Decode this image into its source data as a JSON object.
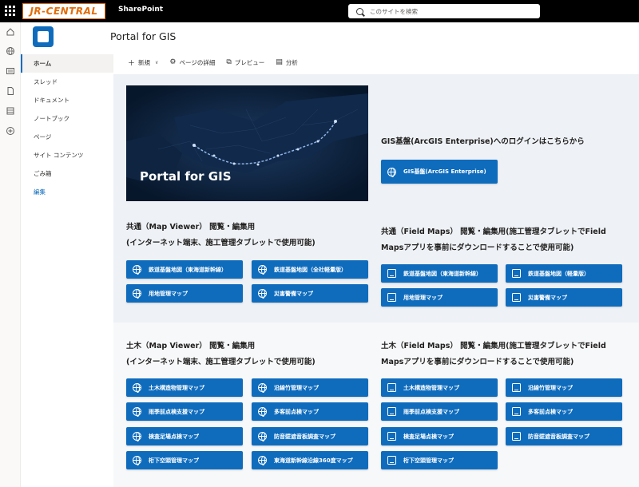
{
  "topbar": {
    "brand": "JR-CENTRAL",
    "app_name": "SharePoint",
    "search_placeholder": "このサイトを検索"
  },
  "site": {
    "title": "Portal for GIS"
  },
  "nav": {
    "items": [
      "ホーム",
      "スレッド",
      "ドキュメント",
      "ノートブック",
      "ページ",
      "サイト コンテンツ",
      "ごみ箱"
    ],
    "edit": "編集"
  },
  "commands": {
    "new": "新規",
    "details": "ページの詳細",
    "preview": "プレビュー",
    "analytics": "分析"
  },
  "hero": {
    "title": "Portal for GIS"
  },
  "login": {
    "heading": "GIS基盤(ArcGIS Enterprise)へのログインはこちらから",
    "button": "GIS基盤(ArcGIS Enterprise)"
  },
  "common_mv": {
    "heading1": "共通（Map Viewer） 閲覧・編集用",
    "heading2": "(インターネット端末、施工管理タブレットで使用可能)",
    "buttons": [
      "鉄道基盤地図（東海道新幹線）",
      "鉄道基盤地図（全社軽量版）",
      "用地管理マップ",
      "災害警備マップ"
    ]
  },
  "common_fm": {
    "heading1": "共通（Field Maps） 閲覧・編集用(施工管理タブレットでField",
    "heading2": "Mapsアプリを事前にダウンロードすることで使用可能)",
    "buttons": [
      "鉄道基盤地図（東海道新幹線）",
      "鉄道基盤地図（軽量版）",
      "用地管理マップ",
      "災害警備マップ"
    ]
  },
  "doboku_mv": {
    "heading1": "土木（Map Viewer） 閲覧・編集用",
    "heading2": "(インターネット端末、施工管理タブレットで使用可能)",
    "buttons": [
      "土木構造物管理マップ",
      "沿線竹管理マップ",
      "雨季前点検支援マップ",
      "多客前点検マップ",
      "検査足場点検マップ",
      "防音壁遮音板調査マップ",
      "桁下空頭管理マップ",
      "東海道新幹線沿線360度マップ"
    ]
  },
  "doboku_fm": {
    "heading1": "土木（Field Maps） 閲覧・編集用(施工管理タブレットでField",
    "heading2": "Mapsアプリを事前にダウンロードすることで使用可能)",
    "buttons": [
      "土木構造物管理マップ",
      "沿線竹管理マップ",
      "雨季前点検支援マップ",
      "多客前点検マップ",
      "検査足場点検マップ",
      "防音壁遮音板調査マップ",
      "桁下空頭管理マップ"
    ]
  },
  "colors": {
    "accent": "#0f6cbd",
    "brand_orange": "#e36c0a",
    "topbar": "#000000"
  }
}
